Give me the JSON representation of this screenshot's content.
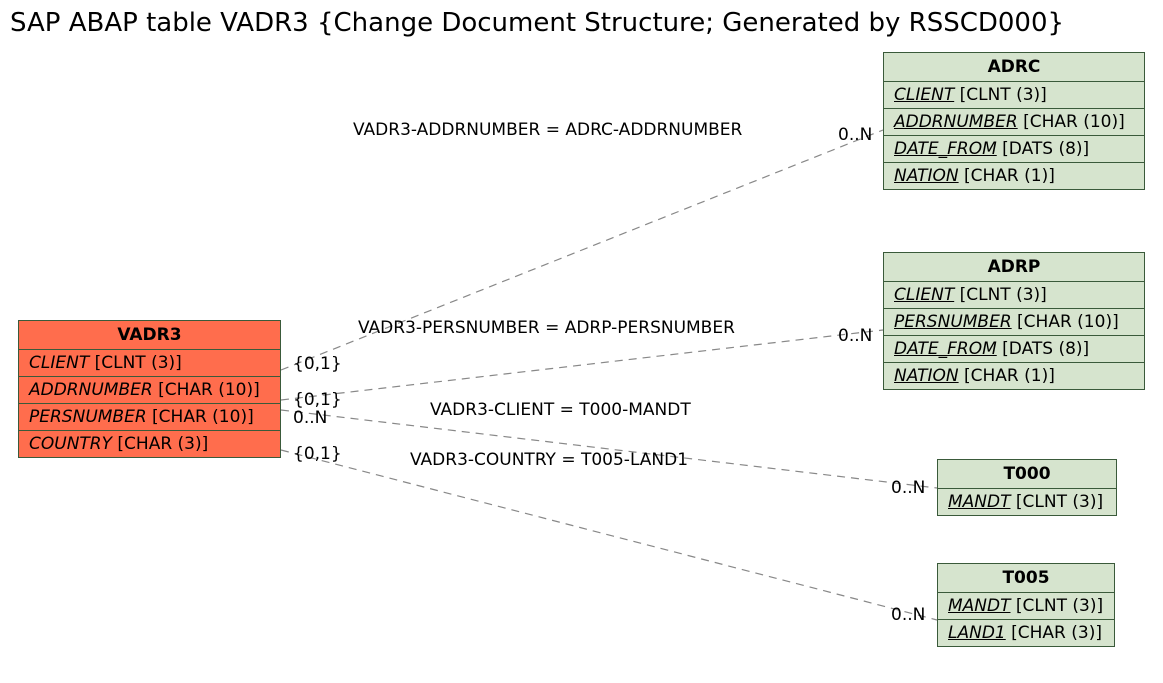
{
  "title": "SAP ABAP table VADR3 {Change Document Structure; Generated by RSSCD000}",
  "entities": {
    "vadr3": {
      "name": "VADR3",
      "fields": [
        {
          "label": "CLIENT",
          "type": "[CLNT (3)]",
          "key": "fkey"
        },
        {
          "label": "ADDRNUMBER",
          "type": "[CHAR (10)]",
          "key": "fkey"
        },
        {
          "label": "PERSNUMBER",
          "type": "[CHAR (10)]",
          "key": "fkey"
        },
        {
          "label": "COUNTRY",
          "type": "[CHAR (3)]",
          "key": "fkey"
        }
      ]
    },
    "adrc": {
      "name": "ADRC",
      "fields": [
        {
          "label": "CLIENT",
          "type": "[CLNT (3)]",
          "key": "pkey"
        },
        {
          "label": "ADDRNUMBER",
          "type": "[CHAR (10)]",
          "key": "pkey"
        },
        {
          "label": "DATE_FROM",
          "type": "[DATS (8)]",
          "key": "pkey"
        },
        {
          "label": "NATION",
          "type": "[CHAR (1)]",
          "key": "pkey"
        }
      ]
    },
    "adrp": {
      "name": "ADRP",
      "fields": [
        {
          "label": "CLIENT",
          "type": "[CLNT (3)]",
          "key": "pkey"
        },
        {
          "label": "PERSNUMBER",
          "type": "[CHAR (10)]",
          "key": "pkey"
        },
        {
          "label": "DATE_FROM",
          "type": "[DATS (8)]",
          "key": "pkey"
        },
        {
          "label": "NATION",
          "type": "[CHAR (1)]",
          "key": "pkey"
        }
      ]
    },
    "t000": {
      "name": "T000",
      "fields": [
        {
          "label": "MANDT",
          "type": "[CLNT (3)]",
          "key": "pkey"
        }
      ]
    },
    "t005": {
      "name": "T005",
      "fields": [
        {
          "label": "MANDT",
          "type": "[CLNT (3)]",
          "key": "pkey"
        },
        {
          "label": "LAND1",
          "type": "[CHAR (3)]",
          "key": "pkey"
        }
      ]
    }
  },
  "relations": [
    {
      "label": "VADR3-ADDRNUMBER = ADRC-ADDRNUMBER",
      "leftCard": "{0,1}",
      "rightCard": "0..N"
    },
    {
      "label": "VADR3-PERSNUMBER = ADRP-PERSNUMBER",
      "leftCard": "{0,1}",
      "rightCard": "0..N"
    },
    {
      "label": "VADR3-CLIENT = T000-MANDT",
      "leftCard": "0..N",
      "rightCard": "0..N"
    },
    {
      "label": "VADR3-COUNTRY = T005-LAND1",
      "leftCard": "{0,1}",
      "rightCard": "0..N"
    }
  ]
}
